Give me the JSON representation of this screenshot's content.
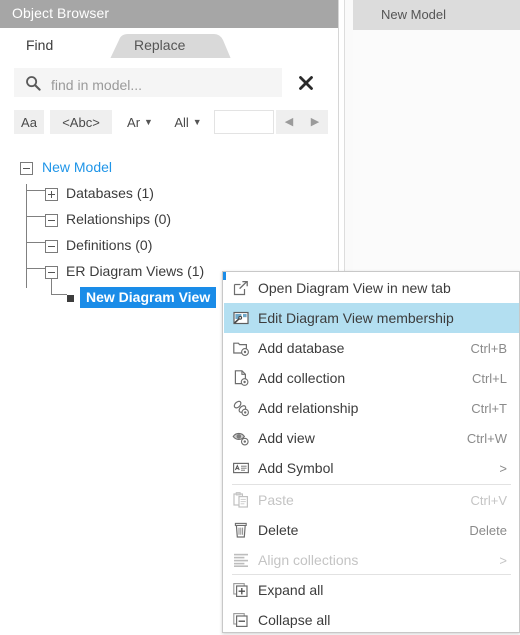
{
  "browser": {
    "title": "Object Browser",
    "tabs": [
      {
        "id": "find",
        "label": "Find",
        "active": true
      },
      {
        "id": "replace",
        "label": "Replace",
        "active": false
      }
    ],
    "search": {
      "placeholder": "find in model...",
      "value": "",
      "icon": "search-icon",
      "clear_icon": "close-icon"
    },
    "options": [
      {
        "id": "match-case",
        "label": "Aa",
        "icon": ""
      },
      {
        "id": "whole-tag",
        "label": "<Abc>",
        "icon": ""
      },
      {
        "id": "language",
        "label": "Ar",
        "caret": "▼"
      },
      {
        "id": "scope",
        "label": "All",
        "caret": "▼"
      },
      {
        "id": "result-count",
        "label": ""
      }
    ],
    "nav": {
      "prev_label": "◀",
      "next_label": "▶"
    },
    "tree": [
      {
        "label": "New Model",
        "state": "expanded",
        "depth": 0,
        "kind": "root"
      },
      {
        "label": "Databases (1)",
        "state": "collapsed",
        "depth": 1,
        "kind": "folder"
      },
      {
        "label": "Relationships (0)",
        "state": "expanded",
        "depth": 1,
        "kind": "folder"
      },
      {
        "label": "Definitions (0)",
        "state": "expanded",
        "depth": 1,
        "kind": "folder"
      },
      {
        "label": "ER Diagram Views (1)",
        "state": "expanded",
        "depth": 1,
        "kind": "folder"
      },
      {
        "label": "New Diagram View",
        "state": "leaf",
        "depth": 2,
        "kind": "leaf",
        "selected": true
      }
    ]
  },
  "editor": {
    "tab_label": "New Model"
  },
  "context_menu": {
    "items": [
      {
        "label": "Open Diagram View in new tab",
        "shortcut": "",
        "icon": "open-in-new-tab-icon",
        "state": "normal",
        "submenu": false
      },
      {
        "label": "Edit Diagram View membership",
        "shortcut": "",
        "icon": "edit-membership-icon",
        "state": "highlighted",
        "submenu": false
      },
      {
        "label": "Add database",
        "shortcut": "Ctrl+B",
        "icon": "add-database-icon",
        "state": "normal",
        "submenu": false
      },
      {
        "label": "Add collection",
        "shortcut": "Ctrl+L",
        "icon": "add-collection-icon",
        "state": "normal",
        "submenu": false
      },
      {
        "label": "Add relationship",
        "shortcut": "Ctrl+T",
        "icon": "add-relationship-icon",
        "state": "normal",
        "submenu": false
      },
      {
        "label": "Add view",
        "shortcut": "Ctrl+W",
        "icon": "add-view-icon",
        "state": "normal",
        "submenu": false
      },
      {
        "label": "Add Symbol",
        "shortcut": ">",
        "icon": "add-symbol-icon",
        "state": "normal",
        "submenu": true
      },
      {
        "label": "Paste",
        "shortcut": "Ctrl+V",
        "icon": "paste-icon",
        "state": "disabled",
        "submenu": false
      },
      {
        "label": "Delete",
        "shortcut": "Delete",
        "icon": "trash-icon",
        "state": "normal",
        "submenu": false
      },
      {
        "label": "Align collections",
        "shortcut": ">",
        "icon": "align-icon",
        "state": "disabled",
        "submenu": true
      },
      {
        "label": "Expand all",
        "shortcut": "",
        "icon": "expand-all-icon",
        "state": "normal",
        "submenu": false
      },
      {
        "label": "Collapse all",
        "shortcut": "",
        "icon": "collapse-all-icon",
        "state": "normal",
        "submenu": false
      }
    ],
    "separators_after": [
      6,
      9
    ]
  },
  "colors": {
    "title_bar": "#a6a6a6",
    "selection_blue": "#1a8ce8",
    "menu_highlight": "#b3dff1",
    "root_label": "#1f95e8",
    "disabled_text": "#c4c4c4"
  }
}
